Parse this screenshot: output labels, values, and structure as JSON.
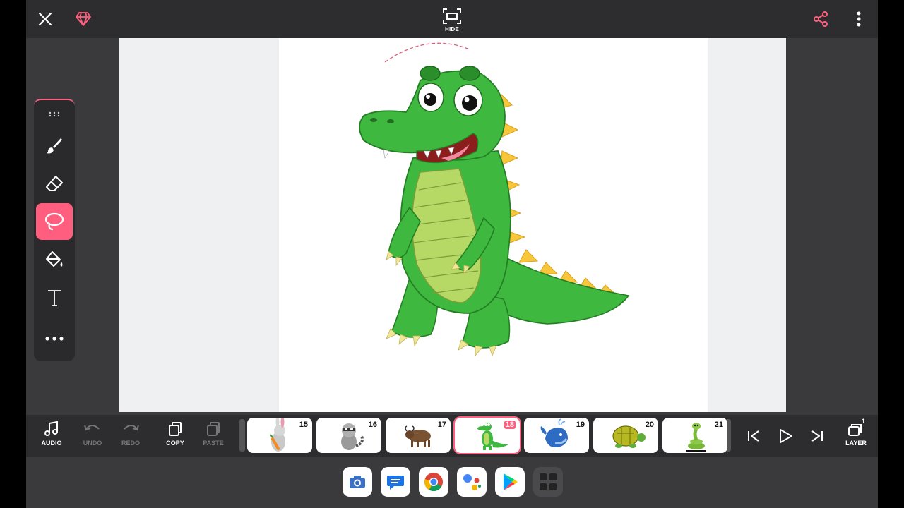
{
  "topbar": {
    "hide_label": "HIDE"
  },
  "icons": {
    "close": "close-icon",
    "premium": "diamond-icon",
    "hide": "hide-toolbar-icon",
    "share": "share-icon",
    "more": "more-vertical-icon"
  },
  "tools": [
    {
      "name": "drag-handle-icon",
      "active": false
    },
    {
      "name": "brush-icon",
      "active": false
    },
    {
      "name": "eraser-icon",
      "active": false
    },
    {
      "name": "lasso-icon",
      "active": true
    },
    {
      "name": "fill-bucket-icon",
      "active": false
    },
    {
      "name": "text-tool-icon",
      "active": false
    },
    {
      "name": "more-horizontal-icon",
      "active": false
    }
  ],
  "actions": {
    "audio": "AUDIO",
    "undo": "UNDO",
    "redo": "REDO",
    "copy": "COPY",
    "paste": "PASTE",
    "layer": "LAYER",
    "layer_count": "1"
  },
  "frames": [
    {
      "number": "15",
      "subject": "rabbit with carrot",
      "selected": false
    },
    {
      "number": "16",
      "subject": "raccoon",
      "selected": false
    },
    {
      "number": "17",
      "subject": "buffalo",
      "selected": false
    },
    {
      "number": "18",
      "subject": "crocodile",
      "selected": true
    },
    {
      "number": "19",
      "subject": "whale",
      "selected": false
    },
    {
      "number": "20",
      "subject": "turtle",
      "selected": false
    },
    {
      "number": "21",
      "subject": "snake",
      "selected": false
    }
  ],
  "dock": [
    "camera-app-icon",
    "messages-app-icon",
    "chrome-app-icon",
    "assistant-app-icon",
    "play-store-app-icon",
    "app-drawer-icon"
  ],
  "colors": {
    "accent": "#ff5e7e",
    "toolbar": "#2d2d2f",
    "background": "#3a3a3c"
  }
}
